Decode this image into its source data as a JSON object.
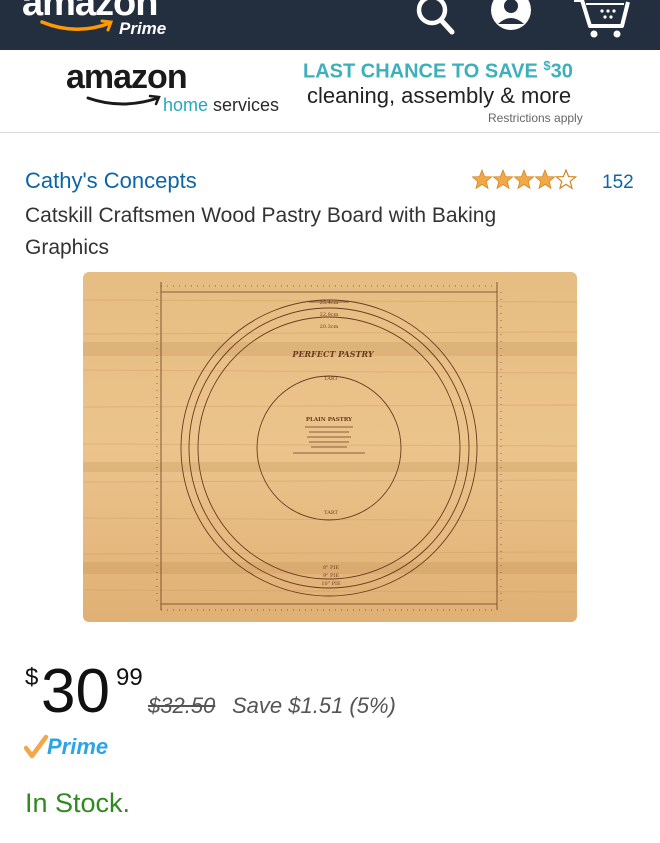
{
  "header": {
    "logo_text": "amazon",
    "logo_prime": "Prime",
    "icons": [
      "search-icon",
      "account-icon",
      "cart-icon"
    ],
    "bg_color": "#232f3e"
  },
  "ad_banner": {
    "brand_name": "amazon",
    "sub_home": "home",
    "sub_services": "services",
    "headline": "LAST CHANCE TO SAVE $30",
    "subline": "cleaning, assembly & more",
    "note": "Restrictions apply",
    "accent_color": "#3cb0bd"
  },
  "product": {
    "brand": "Cathy's Concepts",
    "rating_stars": 4.0,
    "rating_count": "152",
    "title": "Catskill Craftsmen Wood Pastry Board with Baking Graphics",
    "image_labels": {
      "top_sizes": [
        "25.4cm",
        "22.9cm",
        "20.3cm"
      ],
      "perfect_pastry": "PERFECT PASTRY",
      "tart_top": "TART",
      "plain_pastry": "PLAIN PASTRY",
      "tart_bottom": "TART",
      "pie_sizes": [
        "8\" PIE",
        "9\" PIE",
        "10\" PIE"
      ]
    }
  },
  "price": {
    "symbol": "$",
    "whole": "30",
    "fraction": "99",
    "list_price": "$32.50",
    "savings": "Save $1.51 (5%)"
  },
  "prime_label": "Prime",
  "stock_status": "In Stock."
}
